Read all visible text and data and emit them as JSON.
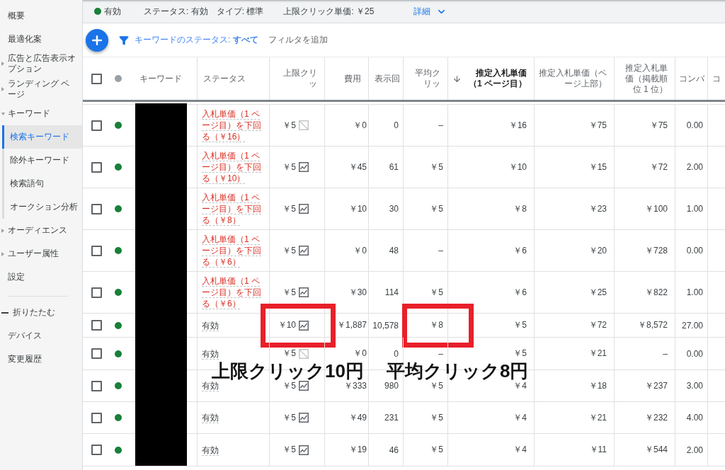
{
  "sidebar": {
    "items": [
      {
        "kind": "link",
        "label": "概要",
        "selected": false
      },
      {
        "kind": "link",
        "label": "最適化案",
        "selected": false
      },
      {
        "kind": "group",
        "label": "広告と広告表示オプション",
        "selected": false,
        "expanded": false
      },
      {
        "kind": "group",
        "label": "ランディング ページ",
        "selected": false,
        "expanded": false
      },
      {
        "kind": "group",
        "label": "キーワード",
        "selected": false,
        "expanded": true,
        "children": [
          {
            "label": "検索キーワード",
            "selected": true
          },
          {
            "label": "除外キーワード",
            "selected": false
          },
          {
            "label": "検索語句",
            "selected": false
          },
          {
            "label": "オークション分析",
            "selected": false
          }
        ]
      },
      {
        "kind": "group",
        "label": "オーディエンス",
        "selected": false,
        "expanded": false
      },
      {
        "kind": "group",
        "label": "ユーザー属性",
        "selected": false,
        "expanded": false
      },
      {
        "kind": "link",
        "label": "設定",
        "selected": false
      }
    ],
    "collapse_label": "折りたたむ",
    "footer_items": [
      {
        "label": "デバイス",
        "selected": false
      },
      {
        "label": "変更履歴",
        "selected": false
      }
    ]
  },
  "summary_bar": {
    "state": "有効",
    "status": "ステータス: 有効",
    "type": "タイプ: 標準",
    "max_cpc": "上限クリック単価: ￥25",
    "details_link": "詳細"
  },
  "toolbar": {
    "filter": "キーワードのステータス: **すべて**",
    "add_filter": "フィルタを追加"
  },
  "table": {
    "keyword_redacted": true,
    "select_all_checked": false,
    "columns": [
      {
        "label": "キーワード",
        "sorted": false
      },
      {
        "label": "ステータス",
        "sorted": false
      },
      {
        "label": "上限クリッ",
        "sorted": false
      },
      {
        "label": "費用",
        "sorted": false
      },
      {
        "label": "表示回",
        "sorted": false
      },
      {
        "label": "平均クリッ",
        "sorted": false
      },
      {
        "label": "推定入札単価（1 ページ目）",
        "sorted": true
      },
      {
        "label": "推定入札単価（ページ上部）",
        "sorted": false
      },
      {
        "label": "推定入札単価（掲載順位 1 位）",
        "sorted": false
      },
      {
        "label": "コンバ",
        "sorted": false
      },
      {
        "label": "コ",
        "sorted": false
      }
    ],
    "rows": [
      {
        "checked": false,
        "below_bid": true,
        "status": "入札単価（1 ページ目）を下回る（￥16）",
        "max_cpc": "￥5",
        "chart_available": false,
        "cost": "￥0",
        "impressions": "0",
        "avg_cpc": "–",
        "est_first_page": "￥16",
        "est_top": "￥75",
        "est_first_pos": "￥75",
        "conversions": "0.00"
      },
      {
        "checked": false,
        "below_bid": true,
        "status": "入札単価（1 ページ目）を下回る（￥10）",
        "max_cpc": "￥5",
        "chart_available": true,
        "cost": "￥45",
        "impressions": "61",
        "avg_cpc": "￥5",
        "est_first_page": "￥10",
        "est_top": "￥15",
        "est_first_pos": "￥72",
        "conversions": "2.00"
      },
      {
        "checked": false,
        "below_bid": true,
        "status": "入札単価（1 ページ目）を下回る（￥8）",
        "max_cpc": "￥5",
        "chart_available": true,
        "cost": "￥10",
        "impressions": "30",
        "avg_cpc": "￥5",
        "est_first_page": "￥8",
        "est_top": "￥23",
        "est_first_pos": "￥100",
        "conversions": "1.00"
      },
      {
        "checked": false,
        "below_bid": true,
        "status": "入札単価（1 ページ目）を下回る（￥6）",
        "max_cpc": "￥5",
        "chart_available": true,
        "cost": "￥0",
        "impressions": "48",
        "avg_cpc": "–",
        "est_first_page": "￥6",
        "est_top": "￥20",
        "est_first_pos": "￥728",
        "conversions": "0.00"
      },
      {
        "checked": false,
        "below_bid": true,
        "status": "入札単価（1 ページ目）を下回る（￥6）",
        "max_cpc": "￥5",
        "chart_available": true,
        "cost": "￥30",
        "impressions": "114",
        "avg_cpc": "￥5",
        "est_first_page": "￥6",
        "est_top": "￥25",
        "est_first_pos": "￥822",
        "conversions": "1.00"
      },
      {
        "checked": false,
        "below_bid": false,
        "status": "有効",
        "max_cpc": "￥10",
        "chart_available": true,
        "max_cpc_marked": true,
        "cost": "￥1,887",
        "impressions": "10,578",
        "avg_cpc": "￥8",
        "avg_cpc_marked": true,
        "est_first_page": "￥5",
        "est_top": "￥72",
        "est_first_pos": "￥8,572",
        "conversions": "27.00"
      },
      {
        "checked": false,
        "below_bid": false,
        "status": "有効",
        "max_cpc": "￥5",
        "chart_available": false,
        "cost": "￥0",
        "impressions": "0",
        "avg_cpc": "–",
        "est_first_page": "￥5",
        "est_top": "￥21",
        "est_first_pos": "–",
        "conversions": "0.00"
      },
      {
        "checked": false,
        "below_bid": false,
        "status": "有効",
        "max_cpc": "￥5",
        "chart_available": true,
        "cost": "￥333",
        "impressions": "980",
        "avg_cpc": "￥5",
        "est_first_page": "￥4",
        "est_top": "￥18",
        "est_first_pos": "￥237",
        "conversions": "3.00"
      },
      {
        "checked": false,
        "below_bid": false,
        "status": "有効",
        "max_cpc": "￥5",
        "chart_available": true,
        "cost": "￥49",
        "impressions": "231",
        "avg_cpc": "￥5",
        "est_first_page": "￥4",
        "est_top": "￥21",
        "est_first_pos": "￥232",
        "conversions": "4.00"
      },
      {
        "checked": false,
        "below_bid": false,
        "status": "有効",
        "max_cpc": "￥5",
        "chart_available": true,
        "cost": "￥19",
        "impressions": "46",
        "avg_cpc": "￥5",
        "est_first_page": "￥4",
        "est_top": "￥11",
        "est_first_pos": "￥544",
        "conversions": "2.00"
      }
    ]
  },
  "annotations": [
    {
      "text": "上限クリック10円"
    },
    {
      "text": "平均クリック8円"
    }
  ]
}
